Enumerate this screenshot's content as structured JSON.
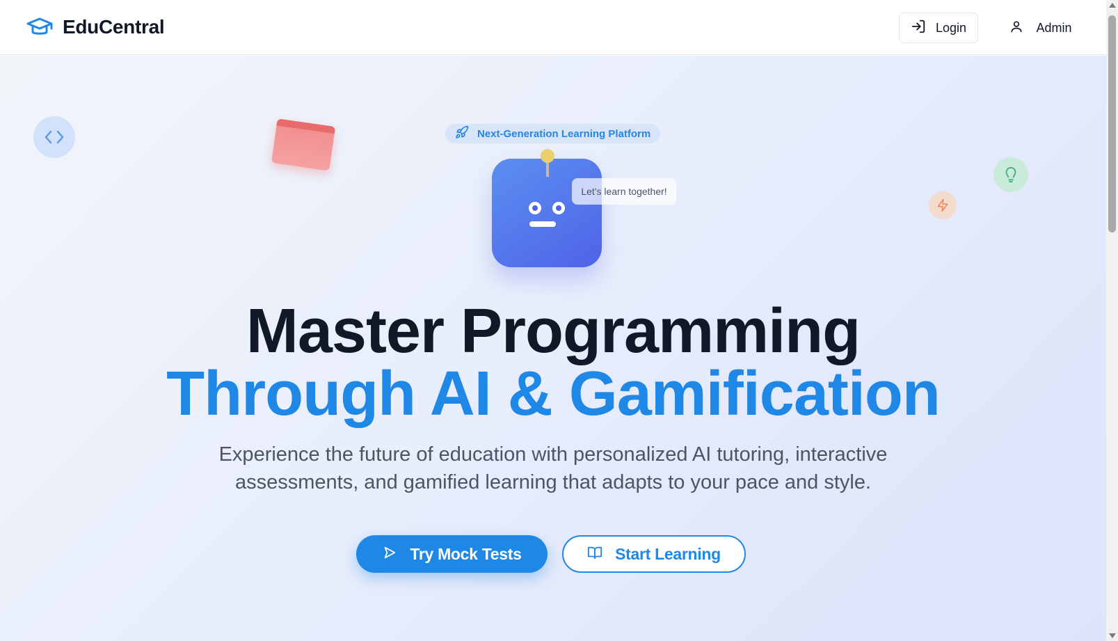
{
  "header": {
    "brand_name": "EduCentral",
    "brand_icon": "graduation-cap-icon",
    "login_label": "Login",
    "login_icon": "log-in-icon",
    "admin_label": "Admin",
    "admin_icon": "user-icon"
  },
  "hero": {
    "badge_label": "Next-Generation Learning Platform",
    "badge_icon": "rocket-icon",
    "speech_bubble": "Let's learn together!",
    "title_line1": "Master Programming",
    "title_line2": "Through AI & Gamification",
    "subtitle": "Experience the future of education with personalized AI tutoring, interactive assessments, and gamified learning that adapts to your pace and style.",
    "primary_button": "Try Mock Tests",
    "primary_button_icon": "send-icon",
    "secondary_button": "Start Learning",
    "secondary_button_icon": "book-open-icon",
    "decorations": [
      "code-icon",
      "card-shape",
      "lightbulb-icon",
      "zap-icon"
    ]
  },
  "colors": {
    "accent": "#1f87e6",
    "heading": "#111827",
    "body_text": "#4b5563",
    "robot": "#4f63e8"
  }
}
